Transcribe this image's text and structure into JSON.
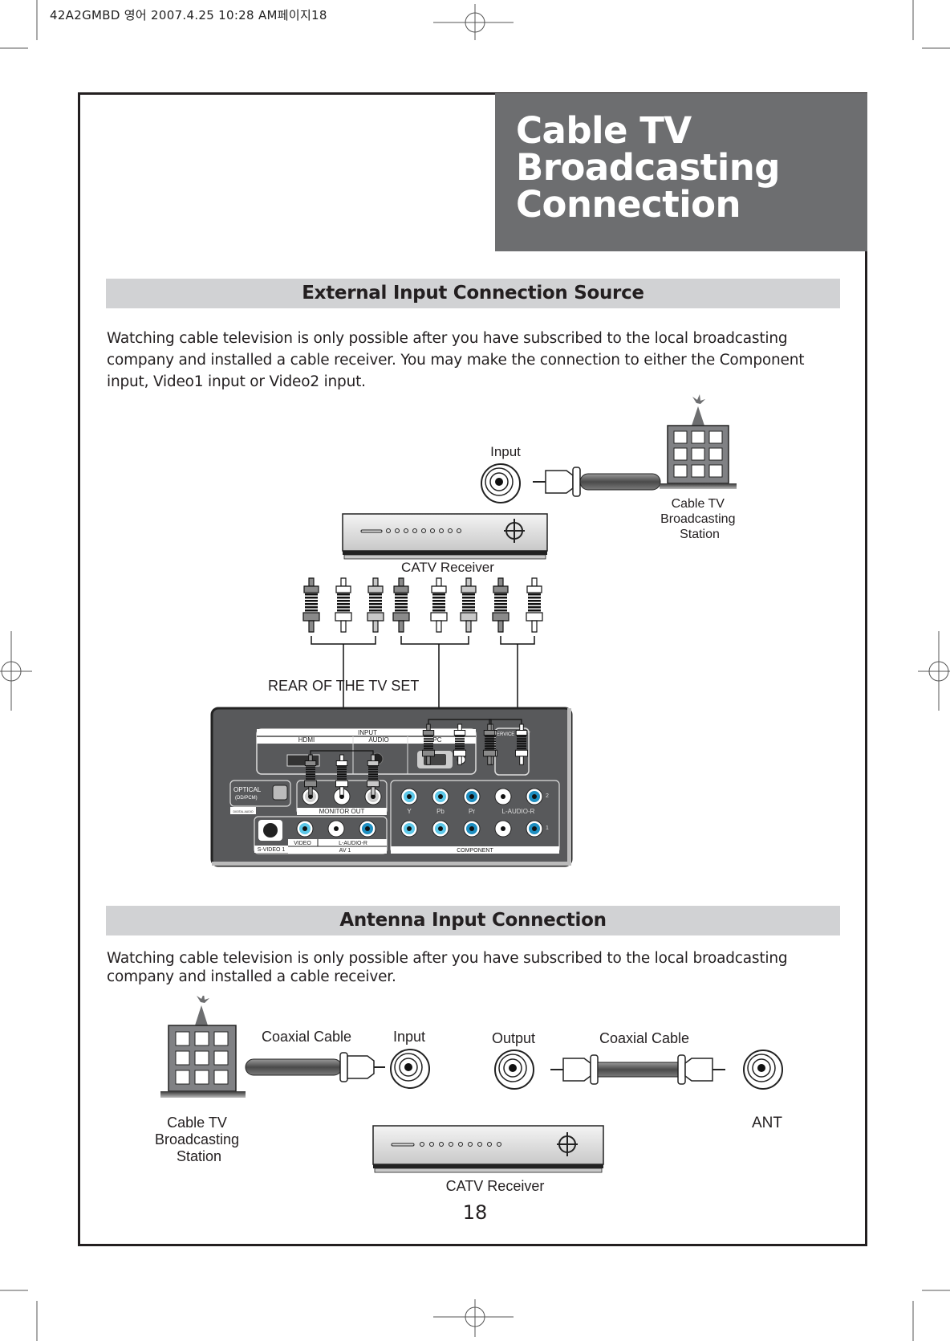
{
  "print_header": "42A2GMBD 영어  2007.4.25 10:28 AM페이지18",
  "title": {
    "lines": [
      "Cable TV",
      "Broadcasting",
      "Connection"
    ]
  },
  "sections": [
    {
      "heading": "External Input Connection Source",
      "body": "Watching cable television is only possible after you have subscribed to the local broadcasting company and installed a cable receiver. You may make the connection to either the Component input, Video1 input or Video2 input."
    },
    {
      "heading": "Antenna Input Connection",
      "body": "Watching cable television is only possible after you have subscribed to the local broadcasting company and installed a cable receiver."
    }
  ],
  "diagram1": {
    "input_label": "Input",
    "station_label_lines": [
      "Cable TV",
      "Broadcasting",
      "Station"
    ],
    "receiver_label": "CATV Receiver",
    "rear_label": "REAR OF THE TV SET",
    "panel": {
      "input": "INPUT",
      "hdmi": "HDMI",
      "audio": "AUDIO",
      "pc": "PC",
      "service_input": "SERVICE INPUT",
      "optical": "OPTICAL",
      "optical_sub": "(DD/PCM)",
      "digital_audio": "DIGITAL AUDIO",
      "monitor_out": "MONITOR OUT",
      "y": "Y",
      "pb": "Pb",
      "pr": "Pr",
      "l_audio_r": "L-AUDIO-R",
      "row2": "2",
      "row1": "1",
      "s_video": "S-VIDEO 1",
      "video": "VIDEO",
      "av1_audio": "L-AUDIO-R",
      "av1": "AV 1",
      "component": "COMPONENT"
    }
  },
  "diagram2": {
    "coax_left_label": "Coaxial Cable",
    "input_label": "Input",
    "output_label": "Output",
    "coax_right_label": "Coaxial Cable",
    "station_label_lines": [
      "Cable TV",
      "Broadcasting",
      "Station"
    ],
    "ant_label": "ANT",
    "receiver_label": "CATV Receiver"
  },
  "page_number": "18",
  "colors": {
    "title_bg": "#6d6e70",
    "section_bar_bg": "#d1d2d4",
    "panel_bg": "#58595b",
    "jack_blue": "#1e9bc8",
    "text": "#231f20"
  }
}
